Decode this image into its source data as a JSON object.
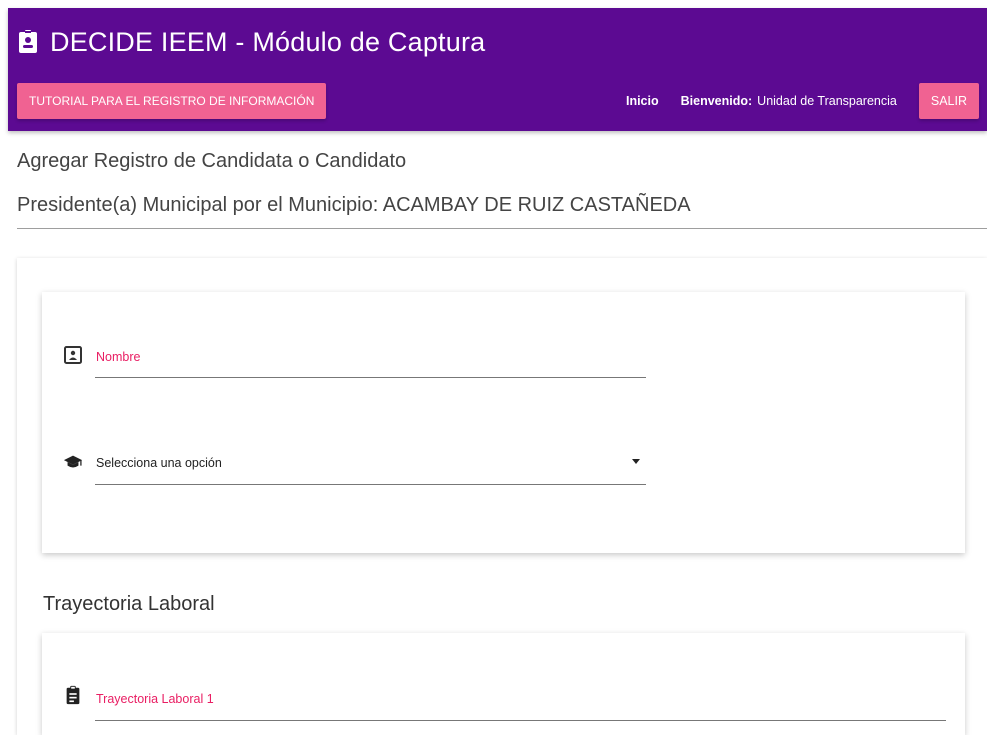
{
  "header": {
    "title": "DECIDE IEEM - Módulo de Captura",
    "icon": "id-badge-icon",
    "tutorial_label": "TUTORIAL PARA EL REGISTRO DE INFORMACIÓN",
    "home_label": "Inicio",
    "welcome_label": "Bienvenido:",
    "welcome_name": "Unidad de Transparencia",
    "logout_label": "SALIR",
    "bg_color": "#5c0a92",
    "accent_color": "#f06292"
  },
  "page": {
    "title": "Agregar Registro de Candidata o Candidato",
    "subtitle": "Presidente(a) Municipal por el Municipio: ACAMBAY DE RUIZ CASTAÑEDA"
  },
  "form": {
    "name_field": {
      "label": "Nombre",
      "icon": "contact-card-icon",
      "value": ""
    },
    "education_select": {
      "selected": "Selecciona una opción",
      "icon": "graduation-cap-icon"
    }
  },
  "trayectoria": {
    "section_title": "Trayectoria Laboral",
    "field_label": "Trayectoria Laboral 1",
    "icon": "clipboard-icon"
  }
}
